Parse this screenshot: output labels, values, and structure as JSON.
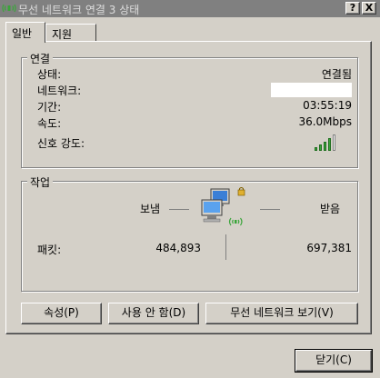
{
  "window": {
    "title": "무선 네트워크 연결 3 상태",
    "help_label": "?",
    "close_label": "X"
  },
  "tabs": [
    {
      "label": "일반"
    },
    {
      "label": "지원"
    }
  ],
  "connection": {
    "group_label": "연결",
    "status_label": "상태:",
    "status_value": "연결됨",
    "network_label": "네트워크:",
    "network_value": "",
    "duration_label": "기간:",
    "duration_value": "03:55:19",
    "speed_label": "속도:",
    "speed_value": "36.0Mbps",
    "signal_label": "신호 강도:",
    "signal_bars_lit": 4,
    "signal_bars_total": 5,
    "signal_color": "#3aa53a"
  },
  "activity": {
    "group_label": "작업",
    "sent_label": "보냄",
    "received_label": "받음",
    "packets_label": "패킷:",
    "packets_sent": "484,893",
    "packets_received": "697,381"
  },
  "buttons": {
    "properties": "속성(P)",
    "disable": "사용 안 함(D)",
    "view_networks": "무선 네트워크 보기(V)",
    "close": "닫기(C)"
  }
}
